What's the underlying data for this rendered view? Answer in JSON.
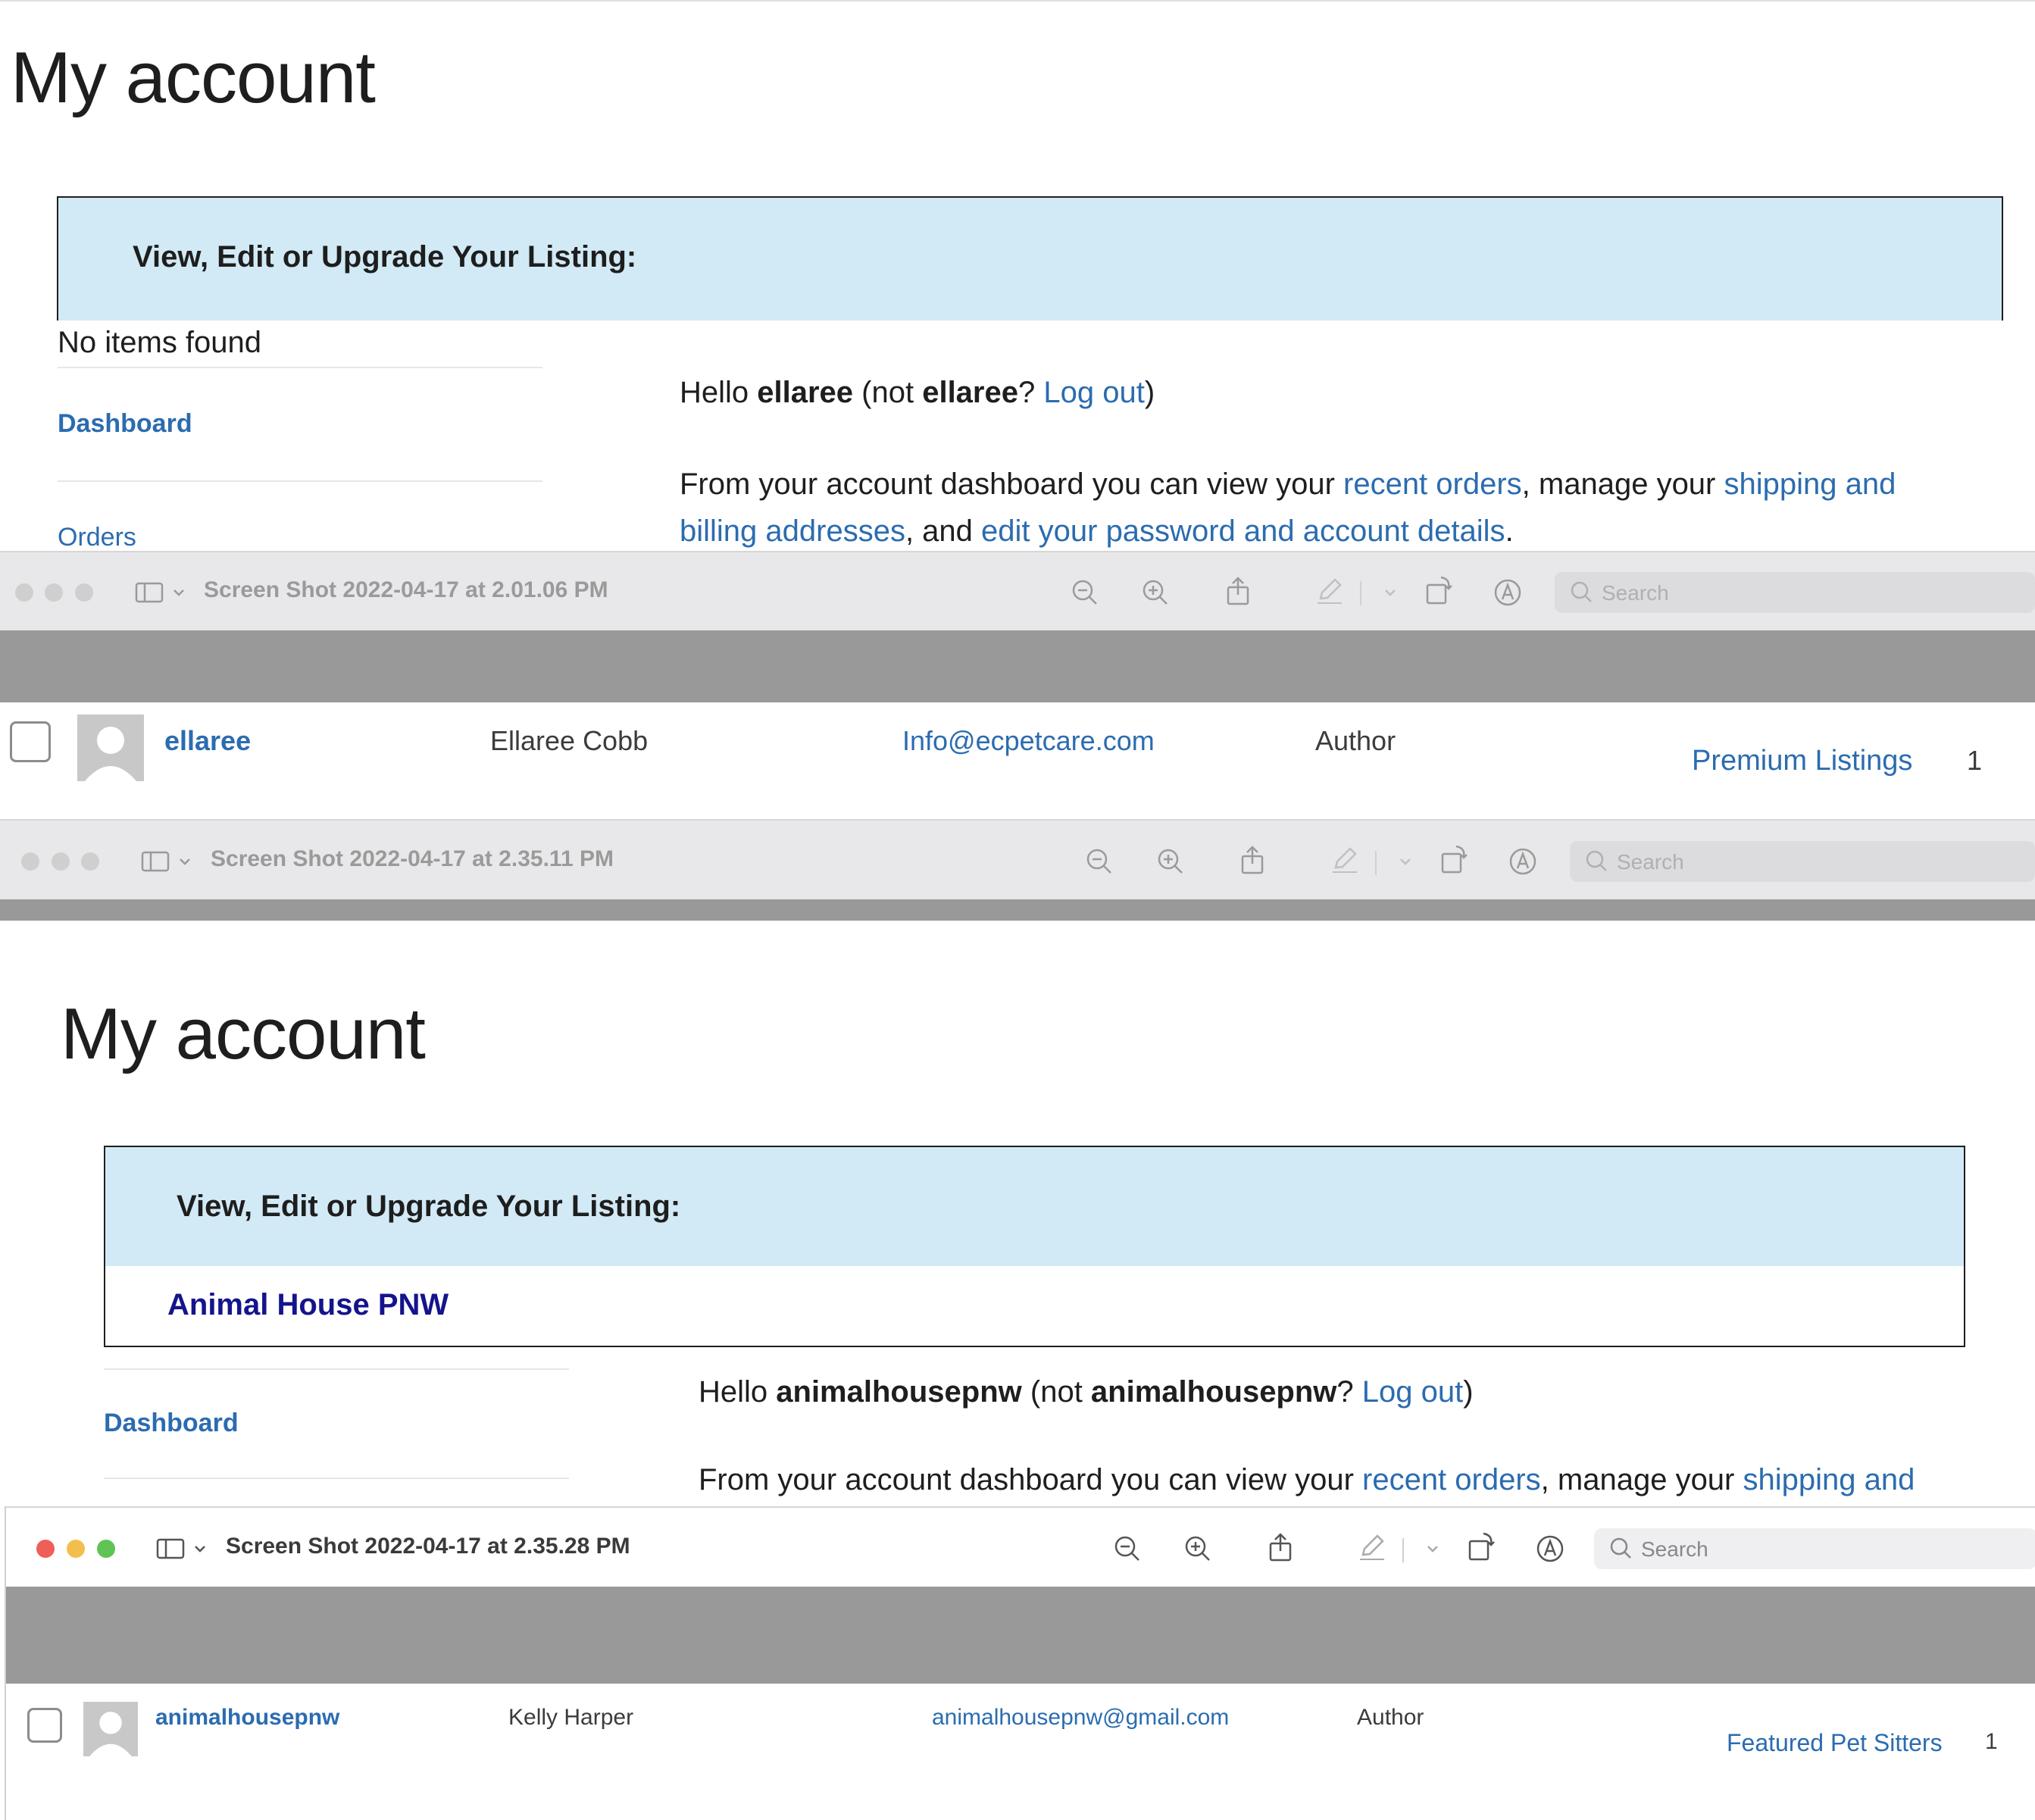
{
  "top_page": {
    "title": "My account",
    "listing_box": {
      "heading": "View, Edit or Upgrade Your Listing:"
    },
    "no_items": "No items found",
    "nav": {
      "dashboard": "Dashboard",
      "orders": "Orders"
    },
    "greeting": {
      "hello": "Hello ",
      "user": "ellaree",
      "not": " (not ",
      "user2": "ellaree",
      "q": "? ",
      "logout": "Log out",
      "close": ")"
    },
    "intro": {
      "p1": "From your account dashboard you can view your ",
      "recent_orders": "recent orders",
      "p2": ", manage your ",
      "shipping": "shipping and",
      "billing": "billing addresses",
      "p3": ", and ",
      "edit": "edit your password and account details",
      "p4": "."
    }
  },
  "window1": {
    "title": "Screen Shot 2022-04-17 at 2.01.06 PM",
    "search_placeholder": "Search",
    "row": {
      "username": "ellaree",
      "name": "Ellaree Cobb",
      "email": "Info@ecpetcare.com",
      "role": "Author",
      "membership": "Premium Listings",
      "count": "1"
    }
  },
  "window2": {
    "title": "Screen Shot 2022-04-17 at 2.35.11 PM",
    "search_placeholder": "Search"
  },
  "second_page": {
    "title": "My account",
    "listing_box": {
      "heading": "View, Edit or Upgrade Your Listing:",
      "listing_link": "Animal House PNW"
    },
    "nav": {
      "dashboard": "Dashboard"
    },
    "greeting": {
      "hello": "Hello ",
      "user": "animalhousepnw",
      "not": " (not ",
      "user2": "animalhousepnw",
      "q": "? ",
      "logout": "Log out",
      "close": ")"
    },
    "intro": {
      "p1": "From your account dashboard you can view your ",
      "recent_orders": "recent orders",
      "p2": ", manage your ",
      "shipping": "shipping and"
    }
  },
  "window3": {
    "title": "Screen Shot 2022-04-17 at 2.35.28 PM",
    "search_placeholder": "Search",
    "row": {
      "username": "animalhousepnw",
      "name": "Kelly Harper",
      "email": "animalhousepnw@gmail.com",
      "role": "Author",
      "membership": "Featured Pet Sitters",
      "count": "1"
    }
  },
  "colors": {
    "link": "#2b6cb0",
    "listing_link": "#14148c",
    "box_head": "#d2eaf5",
    "gray_band": "#999999",
    "traffic_red": "#ee5f57",
    "traffic_yellow": "#f4be4f",
    "traffic_green": "#5fc454"
  },
  "icons": [
    "sidebar-toggle-icon",
    "chevron-down-icon",
    "zoom-out-icon",
    "zoom-in-icon",
    "share-icon",
    "markup-pen-icon",
    "rotate-icon",
    "annotate-icon",
    "search-icon",
    "avatar-placeholder-icon"
  ]
}
